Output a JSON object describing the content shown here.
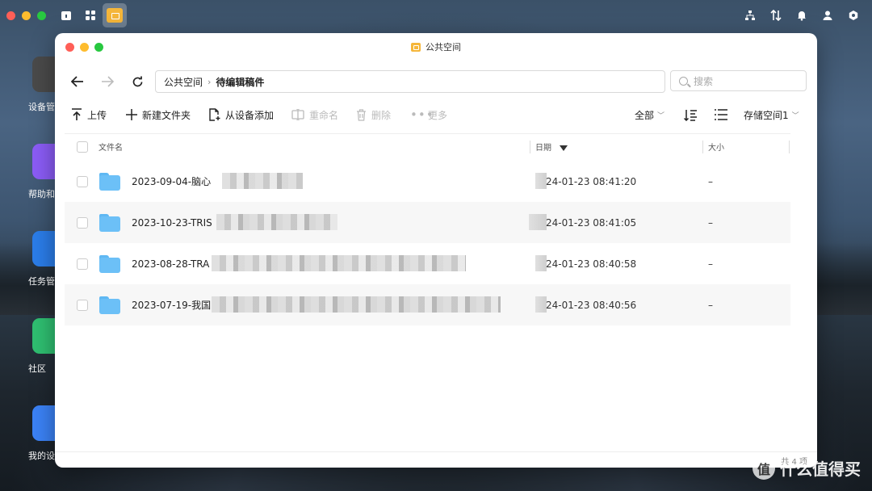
{
  "desktop": {
    "icons": [
      {
        "label": "设备管",
        "color": "#5b5b5b"
      },
      {
        "label": "帮助和",
        "color": "#8b5cf6"
      },
      {
        "label": "任务管",
        "color": "#2b7de9"
      },
      {
        "label": "社区",
        "color": "#2fbf71"
      },
      {
        "label": "我的设",
        "color": "#3b82f6"
      }
    ]
  },
  "topbar": {
    "left_icons": [
      "home-icon",
      "grid-icon",
      "file-manager-icon"
    ],
    "right_icons": [
      "network-icon",
      "transfer-icon",
      "bell-icon",
      "user-icon",
      "settings-icon"
    ]
  },
  "window": {
    "title": "公共空间",
    "path": {
      "root": "公共空间",
      "current": "待编辑稿件"
    },
    "search_placeholder": "搜索",
    "toolbar": {
      "upload": "上传",
      "new_folder": "新建文件夹",
      "add_from_device": "从设备添加",
      "rename": "重命名",
      "delete": "删除",
      "more": "更多",
      "filter": "全部",
      "storage": "存储空间1"
    },
    "columns": {
      "name": "文件名",
      "date": "日期",
      "size": "大小"
    },
    "rows": [
      {
        "name": "2023-09-04-脑心",
        "date": "24-01-23 08:41:20",
        "size": "–"
      },
      {
        "name": "2023-10-23-TRIS",
        "date": "24-01-23 08:41:05",
        "size": "–"
      },
      {
        "name": "2023-08-28-TRA",
        "date": "24-01-23 08:40:58",
        "size": "–"
      },
      {
        "name": "2023-07-19-我国",
        "date": "24-01-23 08:40:56",
        "size": "–"
      }
    ],
    "footer_count": "共 4 项"
  },
  "watermark": {
    "badge": "值",
    "text": "什么值得买"
  }
}
